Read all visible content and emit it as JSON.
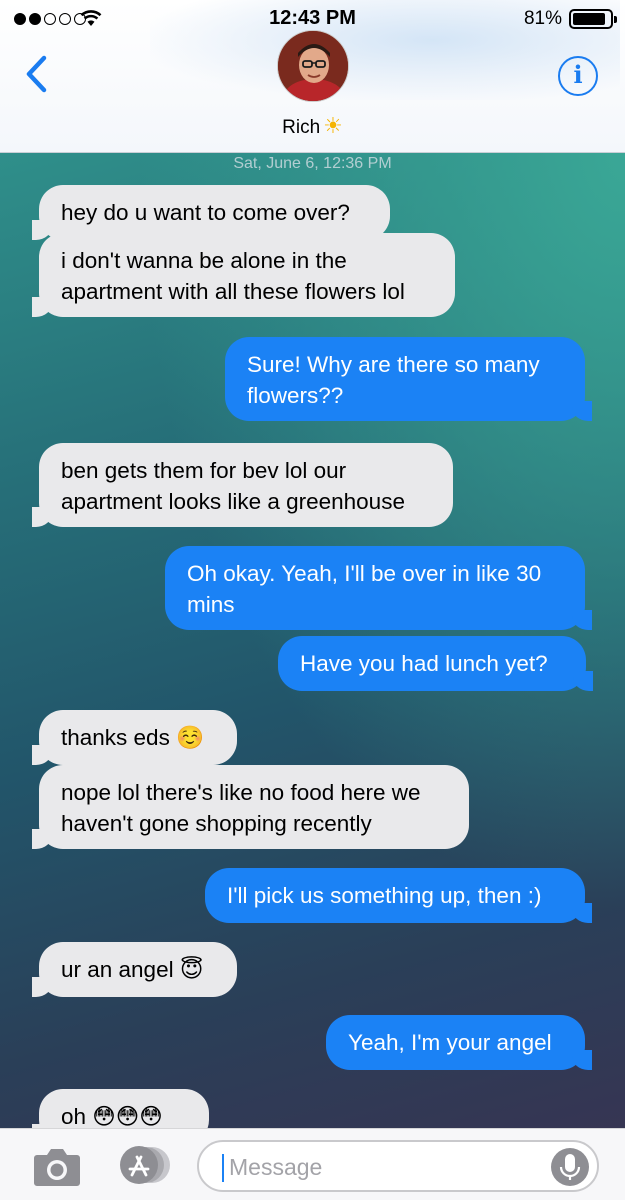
{
  "status_bar": {
    "time": "12:43 PM",
    "battery_percent": "81%",
    "battery_level": 0.81,
    "signal_bars": 2
  },
  "header": {
    "contact_name": "Rich",
    "name_emoji_icon": "sun-icon",
    "back_icon": "chevron-left-icon",
    "info_icon": "info-icon"
  },
  "conversation": {
    "timestamp": "Sat, June 6, 12:36 PM",
    "messages": [
      {
        "direction": "incoming",
        "text": "hey do u want to come over?"
      },
      {
        "direction": "incoming",
        "text": "i don't wanna be alone in the apartment with all these flowers lol"
      },
      {
        "direction": "outgoing",
        "text": "Sure! Why are there so many flowers??"
      },
      {
        "direction": "incoming",
        "text": "ben gets them for bev lol our apartment looks like a greenhouse"
      },
      {
        "direction": "outgoing",
        "text": "Oh okay. Yeah, I'll be over in like 30 mins"
      },
      {
        "direction": "outgoing",
        "text": "Have you had lunch yet?"
      },
      {
        "direction": "incoming",
        "text": "thanks eds ☺️"
      },
      {
        "direction": "incoming",
        "text": "nope lol there's like no food here we haven't gone shopping recently"
      },
      {
        "direction": "outgoing",
        "text": "I'll pick us something up, then :)"
      },
      {
        "direction": "incoming",
        "text": "ur an angel 😇"
      },
      {
        "direction": "outgoing",
        "text": "Yeah, I'm your angel"
      },
      {
        "direction": "incoming",
        "text": "oh 😳😳😳"
      }
    ]
  },
  "input_bar": {
    "placeholder": "Message",
    "camera_icon": "camera-icon",
    "apps_icon": "app-store-icon",
    "mic_icon": "microphone-icon"
  },
  "colors": {
    "outgoing_bubble": "#1b82f5",
    "incoming_bubble": "#e9e9eb",
    "accent": "#1a7cf0"
  }
}
